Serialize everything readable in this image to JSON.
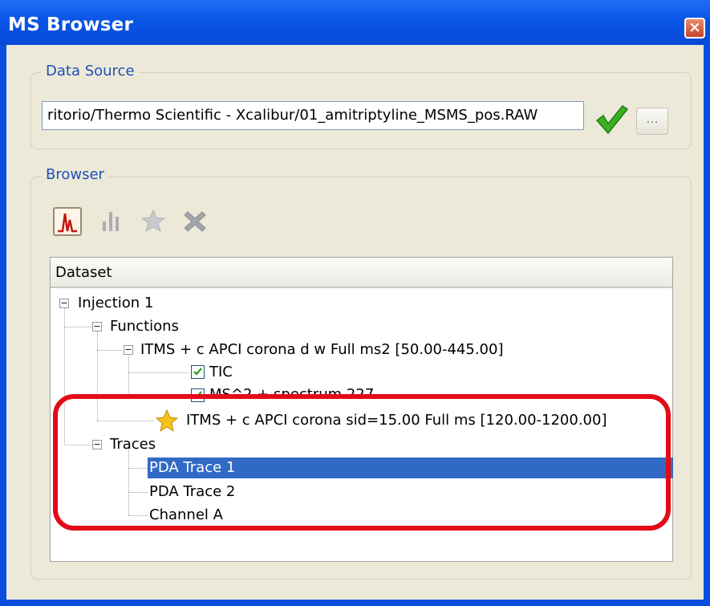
{
  "window": {
    "title": "MS Browser",
    "close_label": "×"
  },
  "data_source": {
    "label": "Data Source",
    "path": "ritorio/Thermo Scientific - Xcalibur/01_amitriptyline_MSMS_pos.RAW",
    "browse_label": "..."
  },
  "browser": {
    "label": "Browser",
    "toolbar": [
      {
        "name": "chromatogram-icon",
        "active": true
      },
      {
        "name": "spectrum-icon",
        "active": false
      },
      {
        "name": "star-icon",
        "active": false
      },
      {
        "name": "remove-icon",
        "active": false
      }
    ],
    "tree_header": "Dataset",
    "tree": {
      "injection": "Injection 1",
      "functions": "Functions",
      "function1": "ITMS + c APCI corona d w Full ms2  [50.00-445.00]",
      "tic": "TIC",
      "spectrum": "MS^2 + spectrum 227",
      "function2": "ITMS + c APCI corona sid=15.00  Full ms [120.00-1200.00]",
      "traces": "Traces",
      "trace1": "PDA Trace 1",
      "trace2": "PDA Trace 2",
      "channel": "Channel A"
    }
  },
  "colors": {
    "titlebar": "#0a56e8",
    "selection": "#316ac5",
    "highlight": "#e30b17",
    "groupbox_label": "#1f4fb8"
  }
}
